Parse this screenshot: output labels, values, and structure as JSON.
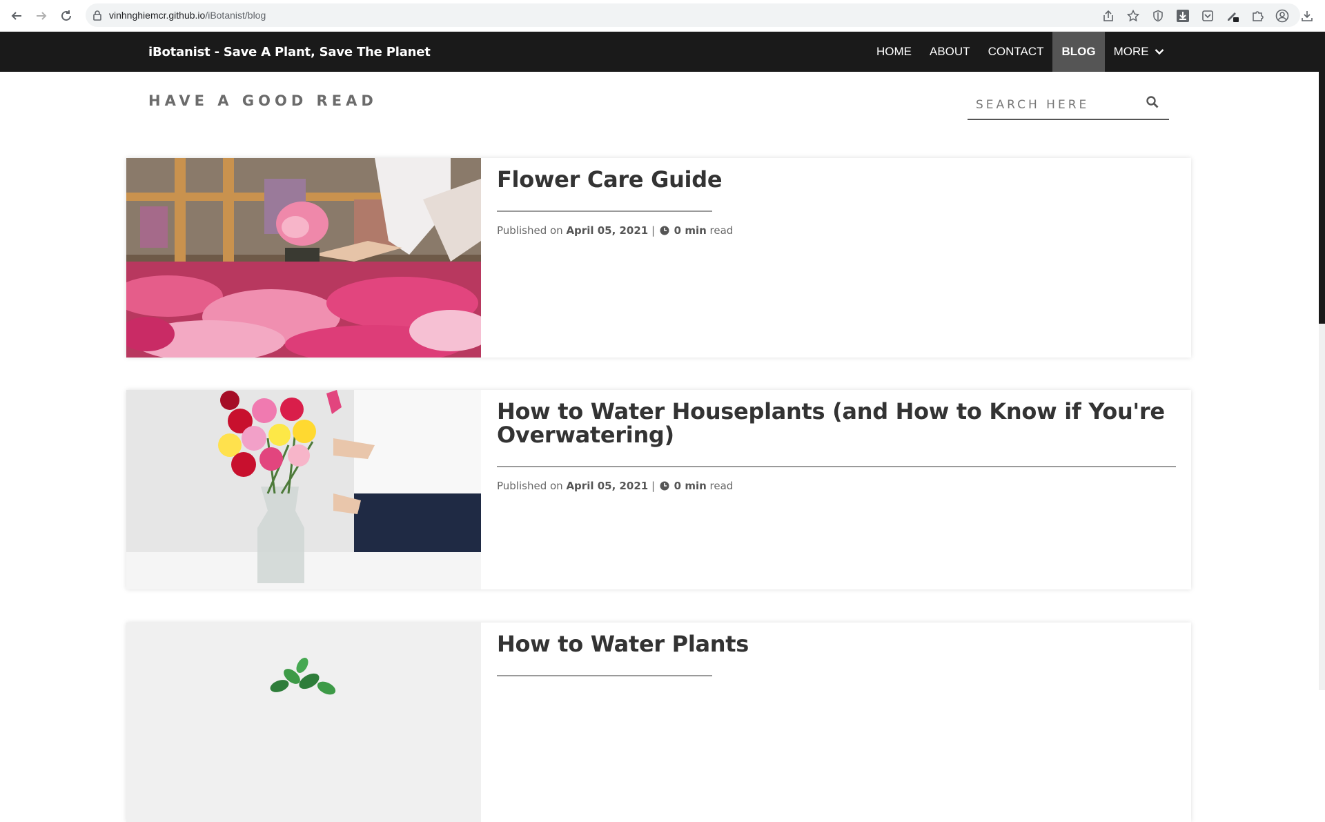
{
  "browser": {
    "url_host": "vinhnghiemcr.github.io",
    "url_path": "/iBotanist/blog"
  },
  "navbar": {
    "brand": "iBotanist - Save A Plant, Save The Planet",
    "links": [
      {
        "label": "HOME",
        "active": false
      },
      {
        "label": "ABOUT",
        "active": false
      },
      {
        "label": "CONTACT",
        "active": false
      },
      {
        "label": "BLOG",
        "active": true
      },
      {
        "label": "MORE",
        "active": false
      }
    ]
  },
  "page": {
    "section_title": "HAVE A GOOD READ",
    "search_placeholder": "SEARCH HERE"
  },
  "posts": [
    {
      "title": "Flower Care Guide",
      "published_prefix": "Published on",
      "date": "April 05, 2021",
      "separator": "|",
      "read_time": "0 min",
      "read_suffix": "read"
    },
    {
      "title": "How to Water Houseplants (and How to Know if You're Overwatering)",
      "published_prefix": "Published on",
      "date": "April 05, 2021",
      "separator": "|",
      "read_time": "0 min",
      "read_suffix": "read"
    },
    {
      "title": "How to Water Plants"
    }
  ],
  "colors": {
    "navbar_bg": "#1a1a1a",
    "active_nav_bg": "#555555",
    "text_dark": "#333333"
  }
}
